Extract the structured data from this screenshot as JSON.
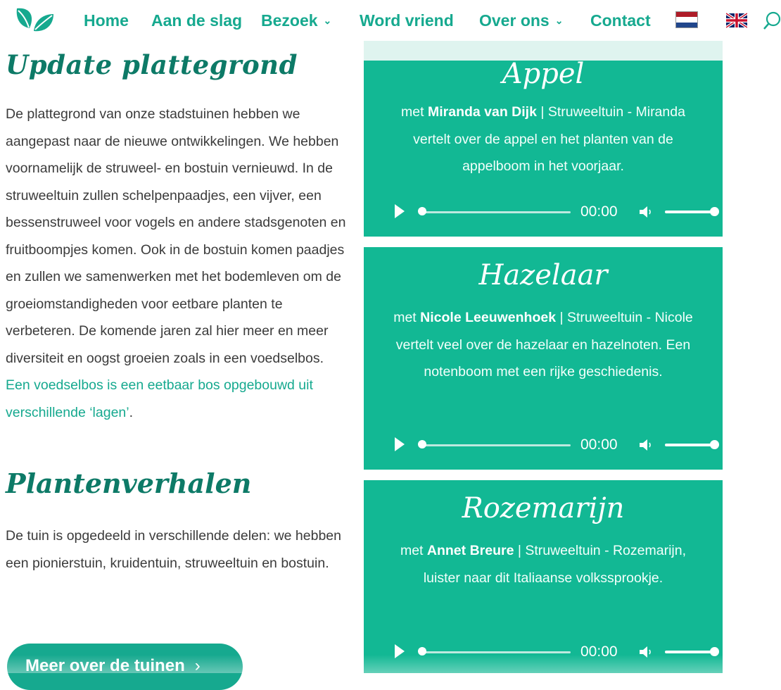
{
  "nav": {
    "items": [
      {
        "label": "Home",
        "dropdown": false
      },
      {
        "label": "Aan de slag",
        "dropdown": false
      },
      {
        "label": "Bezoek",
        "dropdown": true
      },
      {
        "label": "Word vriend",
        "dropdown": false
      },
      {
        "label": "Over ons",
        "dropdown": true
      },
      {
        "label": "Contact",
        "dropdown": false
      }
    ],
    "chevron": "⌄",
    "languages": [
      "NL flag",
      "UK flag"
    ]
  },
  "left": {
    "plan_title": "Update plattegrond",
    "plan_paragraph": "De plattegrond van onze stadstuinen hebben we aangepast naar de nieuwe ontwikkelingen. We hebben voornamelijk de struweel- en bostuin vernieuwd. In de struweeltuin zullen schelpenpaadjes, een vijver, een bessenstruweel voor vogels en andere stadsgenoten en fruitboompjes komen. Ook in de bostuin komen paadjes en zullen we samenwerken met het bodemleven om de groeiomstandigheden voor eetbare planten te verbeteren. De komende jaren zal hier meer en meer diversiteit en oogst groeien zoals in een voedselbos. ",
    "plan_link": "Een voedselbos is een eetbaar bos opgebouwd uit verschillende ‘lagen’",
    "plan_end": ".",
    "stories_title": "Plantenverhalen",
    "stories_paragraph": "De tuin is opgedeeld in verschillende delen: we hebben een pionierstuin, kruidentuin, struweeltuin en bostuin.",
    "cta_label": "Meer over de tuinen",
    "cta_chevron": "›"
  },
  "cards": [
    {
      "title": "Appel",
      "prefix": "met ",
      "person": "Miranda van Dijk",
      "text": " | Struweeltuin - Miranda vertelt over de appel en het planten van de appelboom in het voorjaar.",
      "time": "00:00",
      "progress_fraction": 0,
      "volume_fraction": 1
    },
    {
      "title": "Hazelaar",
      "prefix": "met ",
      "person": "Nicole Leeuwenhoek",
      "text": " | Struweeltuin - Nicole vertelt veel over de hazelaar en hazelnoten. Een notenboom met een rijke geschiedenis.",
      "time": "00:00",
      "progress_fraction": 0,
      "volume_fraction": 1
    },
    {
      "title": "Rozemarijn",
      "prefix": "met ",
      "person": "Annet Breure",
      "text": " | Struweeltuin - Rozemarijn, luister naar dit Italiaanse volkssprookje.",
      "time": "00:00",
      "progress_fraction": 0,
      "volume_fraction": 1
    }
  ],
  "colors": {
    "brand_green": "#16a98f",
    "card_green": "#12b894",
    "heading_green": "#0d7a67"
  }
}
